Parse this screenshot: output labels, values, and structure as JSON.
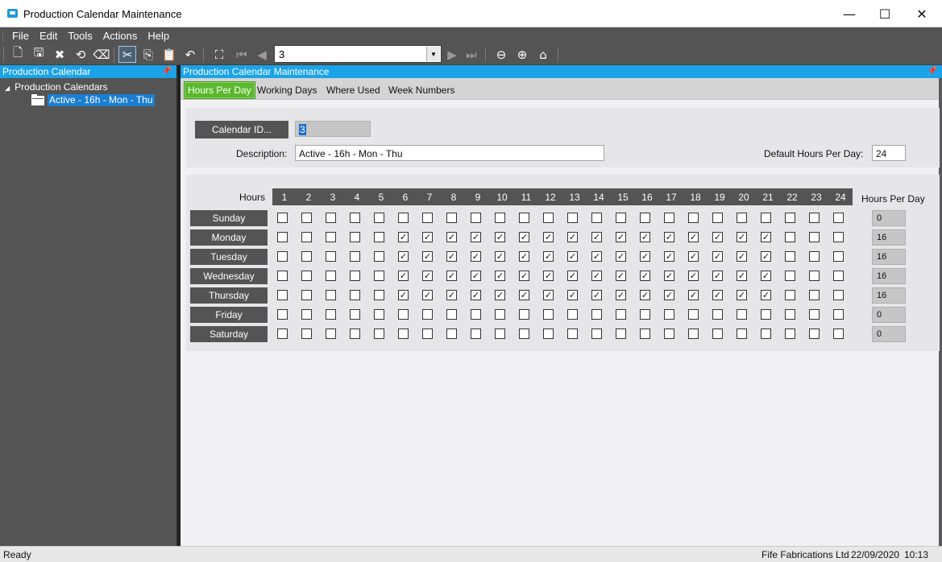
{
  "window": {
    "title": "Production Calendar Maintenance",
    "controls": {
      "minimize": "—",
      "maximize": "☐",
      "close": "✕"
    }
  },
  "menu": {
    "items": [
      "File",
      "Edit",
      "Tools",
      "Actions",
      "Help"
    ]
  },
  "toolbar": {
    "record_combo_value": "3",
    "icons": [
      "new-icon",
      "save-icon",
      "delete-icon",
      "refresh-icon",
      "clear-icon",
      "cut-icon",
      "copy-icon",
      "paste-icon",
      "undo-icon",
      "search-icon",
      "first-record-icon",
      "previous-record-icon",
      "next-record-icon",
      "last-record-icon",
      "back-icon",
      "forward-icon",
      "home-icon"
    ]
  },
  "left_panel": {
    "header": "Production Calendar",
    "tree_root": "Production Calendars",
    "tree_node": "Active - 16h - Mon - Thu"
  },
  "main_panel": {
    "header": "Production Calendar Maintenance",
    "tabs": [
      "Hours Per Day",
      "Working Days",
      "Where Used",
      "Week Numbers"
    ],
    "active_tab": "Hours Per Day"
  },
  "form": {
    "calendar_id_button": "Calendar ID...",
    "calendar_id_value": "3",
    "description_label": "Description:",
    "description_value": "Active - 16h - Mon - Thu",
    "default_hours_label": "Default Hours Per Day:",
    "default_hours_value": "24"
  },
  "grid": {
    "hours_label": "Hours",
    "hours_per_day_label": "Hours Per Day",
    "hours": [
      "1",
      "2",
      "3",
      "4",
      "5",
      "6",
      "7",
      "8",
      "9",
      "10",
      "11",
      "12",
      "13",
      "14",
      "15",
      "16",
      "17",
      "18",
      "19",
      "20",
      "21",
      "22",
      "23",
      "24"
    ],
    "days": [
      {
        "name": "Sunday",
        "total": "0",
        "checked_from": 0,
        "checked_to": 0
      },
      {
        "name": "Monday",
        "total": "16",
        "checked_from": 6,
        "checked_to": 21
      },
      {
        "name": "Tuesday",
        "total": "16",
        "checked_from": 6,
        "checked_to": 21
      },
      {
        "name": "Wednesday",
        "total": "16",
        "checked_from": 6,
        "checked_to": 21
      },
      {
        "name": "Thursday",
        "total": "16",
        "checked_from": 6,
        "checked_to": 21
      },
      {
        "name": "Friday",
        "total": "0",
        "checked_from": 0,
        "checked_to": 0
      },
      {
        "name": "Saturday",
        "total": "0",
        "checked_from": 0,
        "checked_to": 0
      }
    ]
  },
  "status": {
    "left": "Ready",
    "company": "Fife Fabrications Ltd",
    "date": "22/09/2020",
    "time": "10:13"
  }
}
